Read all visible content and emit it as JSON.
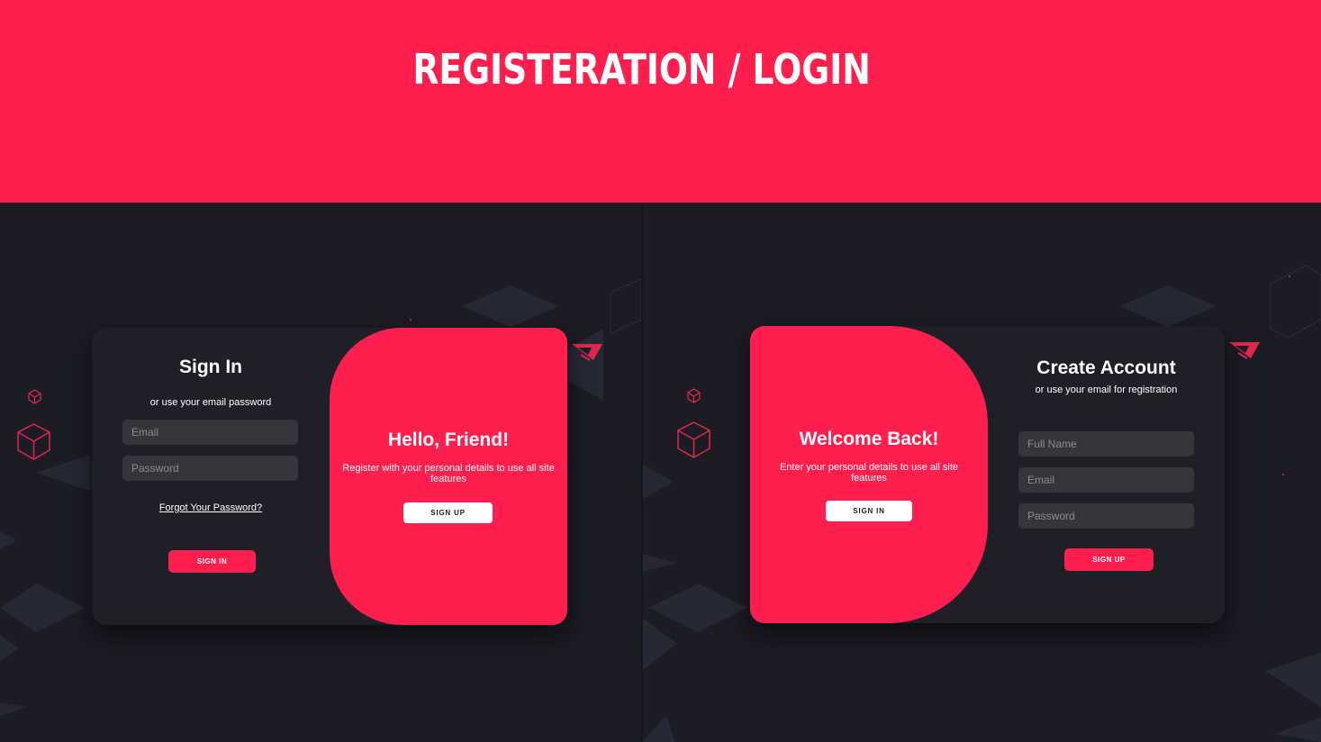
{
  "header": {
    "title": "REGISTERATION / LOGIN"
  },
  "sign_in_panel": {
    "title": "Sign In",
    "subtitle": "or use your email password",
    "email_placeholder": "Email",
    "password_placeholder": "Password",
    "forgot_link": "Forgot Your Password?",
    "submit_label": "SIGN IN",
    "overlay": {
      "title": "Hello, Friend!",
      "text": "Register with your personal details to use all site features",
      "button_label": "SIGN UP"
    }
  },
  "sign_up_panel": {
    "title": "Create Account",
    "subtitle": "or use your email for registration",
    "name_placeholder": "Full Name",
    "email_placeholder": "Email",
    "password_placeholder": "Password",
    "submit_label": "SIGN UP",
    "overlay": {
      "title": "Welcome Back!",
      "text": "Enter your personal details to use all site features",
      "button_label": "SIGN IN"
    }
  },
  "colors": {
    "accent": "#ff1f4e",
    "background": "#1b1c24",
    "card": "#1f2027",
    "field": "#35363c"
  }
}
